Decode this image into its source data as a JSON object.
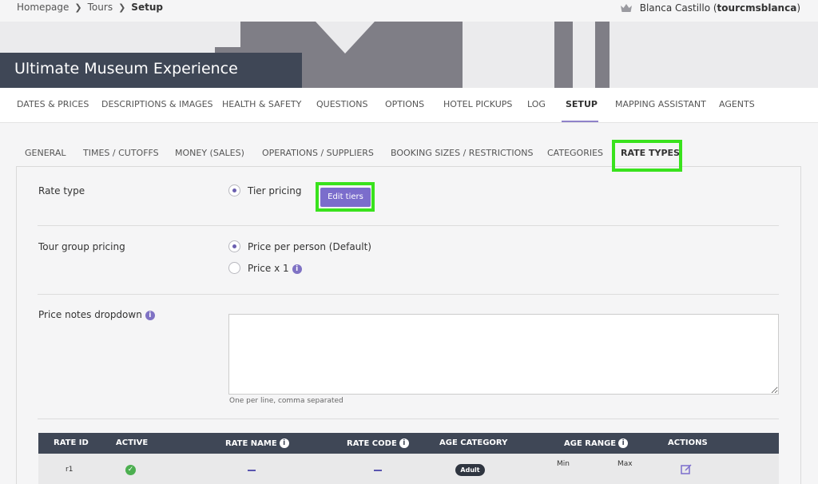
{
  "breadcrumb": {
    "home": "Homepage",
    "tours": "Tours",
    "current": "Setup"
  },
  "user": {
    "name": "Blanca Castillo",
    "handle": "tourcmsblanca"
  },
  "page_title": "Ultimate Museum Experience",
  "main_nav": [
    "DATES & PRICES",
    "DESCRIPTIONS & IMAGES",
    "HEALTH & SAFETY",
    "QUESTIONS",
    "OPTIONS",
    "HOTEL PICKUPS",
    "LOG",
    "SETUP",
    "MAPPING ASSISTANT",
    "AGENTS"
  ],
  "main_nav_active": "SETUP",
  "sub_nav": [
    "GENERAL",
    "TIMES / CUTOFFS",
    "MONEY (SALES)",
    "OPERATIONS / SUPPLIERS",
    "BOOKING SIZES / RESTRICTIONS",
    "CATEGORIES",
    "RATE TYPES"
  ],
  "sub_nav_active": "RATE TYPES",
  "rate_type": {
    "label": "Rate type",
    "option": "Tier pricing",
    "button": "Edit tiers"
  },
  "group_pricing": {
    "label": "Tour group pricing",
    "opt1": "Price per person (Default)",
    "opt2": "Price x 1"
  },
  "price_notes": {
    "label": "Price notes dropdown",
    "hint": "One per line, comma separated",
    "value": ""
  },
  "table": {
    "headers": {
      "rate_id": "RATE ID",
      "active": "ACTIVE",
      "rate_name": "RATE NAME",
      "rate_code": "RATE CODE",
      "age_category": "AGE CATEGORY",
      "age_range": "AGE RANGE",
      "actions": "ACTIONS"
    },
    "row": {
      "rate_id": "r1",
      "age_category": "Adult",
      "min": "Min",
      "max": "Max"
    }
  },
  "colors": {
    "accent": "#7b6dcc",
    "header": "#3f4756",
    "highlight": "#39e21d"
  }
}
